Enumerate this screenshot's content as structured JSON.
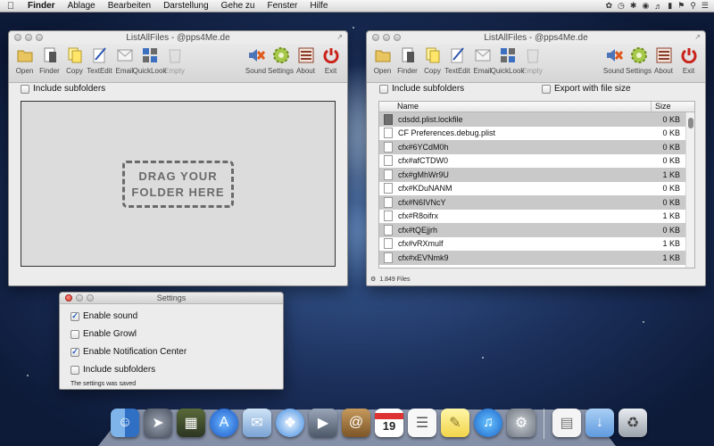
{
  "menubar": {
    "app": "Finder",
    "menus": [
      "Ablage",
      "Bearbeiten",
      "Darstellung",
      "Gehe zu",
      "Fenster",
      "Hilfe"
    ]
  },
  "toolbar": {
    "open": "Open",
    "finder": "Finder",
    "copy": "Copy",
    "textedit": "TextEdit",
    "email": "Email",
    "quicklook": "QuickLook",
    "empty": "Empty",
    "sound": "Sound",
    "settings": "Settings",
    "about": "About",
    "exit": "Exit"
  },
  "left_window": {
    "title": "ListAllFiles - @pps4Me.de",
    "include_subfolders": "Include subfolders",
    "drop_line1": "DRAG YOUR",
    "drop_line2": "FOLDER HERE"
  },
  "right_window": {
    "title": "ListAllFiles - @pps4Me.de",
    "include_subfolders": "Include subfolders",
    "export_with_size": "Export with file size",
    "columns": {
      "name": "Name",
      "size": "Size"
    },
    "files": [
      {
        "name": "cdsdd.plist.lockfile",
        "size": "0 KB"
      },
      {
        "name": "CF Preferences.debug.plist",
        "size": "0 KB"
      },
      {
        "name": "cfx#6YCdM0h",
        "size": "0 KB"
      },
      {
        "name": "cfx#afCTDW0",
        "size": "0 KB"
      },
      {
        "name": "cfx#gMhWr9U",
        "size": "1 KB"
      },
      {
        "name": "cfx#KDuNANM",
        "size": "0 KB"
      },
      {
        "name": "cfx#N6IVNcY",
        "size": "0 KB"
      },
      {
        "name": "cfx#R8oifrx",
        "size": "1 KB"
      },
      {
        "name": "cfx#tQEjjrh",
        "size": "0 KB"
      },
      {
        "name": "cfx#vRXmulf",
        "size": "1 KB"
      },
      {
        "name": "cfx#xEVNmk9",
        "size": "1 KB"
      }
    ],
    "status": "1.849 Files"
  },
  "settings_window": {
    "title": "Settings",
    "enable_sound": "Enable sound",
    "enable_growl": "Enable Growl",
    "enable_notification_center": "Enable Notification Center",
    "include_subfolders": "Include subfolders",
    "saved_message": "The settings was saved"
  },
  "dock": {
    "calendar_day": "19"
  }
}
